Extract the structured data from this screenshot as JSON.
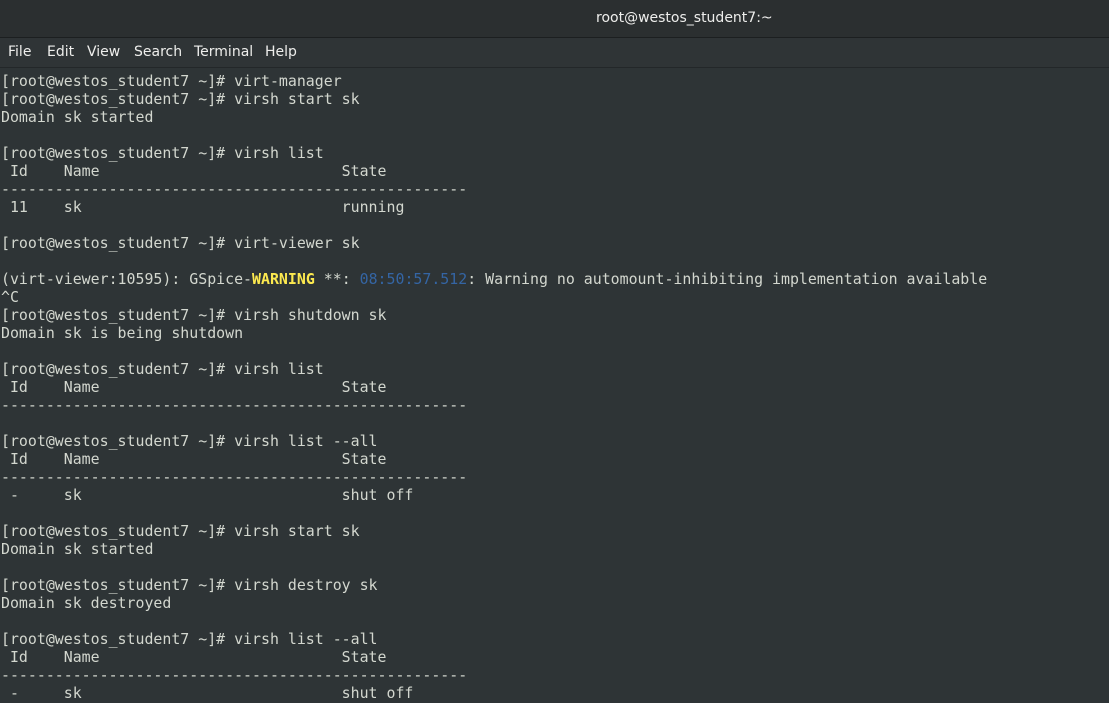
{
  "window": {
    "title": "root@westos_student7:~"
  },
  "menu": {
    "items": [
      "File",
      "Edit",
      "View",
      "Search",
      "Terminal",
      "Help"
    ]
  },
  "terminal": {
    "lines": [
      "[root@westos_student7 ~]# virt-manager",
      "[root@westos_student7 ~]# virsh start sk",
      "Domain sk started",
      "",
      "[root@westos_student7 ~]# virsh list",
      " Id    Name                           State",
      "----------------------------------------------------",
      " 11    sk                             running",
      "",
      "[root@westos_student7 ~]# virt-viewer sk",
      "",
      "(virt-viewer:10595): GSpice-|WARNING| **: |08:50:57.512|: Warning no automount-inhibiting implementation available",
      "^C",
      "[root@westos_student7 ~]# virsh shutdown sk",
      "Domain sk is being shutdown",
      "",
      "[root@westos_student7 ~]# virsh list",
      " Id    Name                           State",
      "----------------------------------------------------",
      "",
      "[root@westos_student7 ~]# virsh list --all",
      " Id    Name                           State",
      "----------------------------------------------------",
      " -     sk                             shut off",
      "",
      "[root@westos_student7 ~]# virsh start sk",
      "Domain sk started",
      "",
      "[root@westos_student7 ~]# virsh destroy sk",
      "Domain sk destroyed",
      "",
      "[root@westos_student7 ~]# virsh list --all",
      " Id    Name                           State",
      "----------------------------------------------------",
      " -     sk                             shut off"
    ],
    "colors": {
      "background": "#2e3436",
      "foreground": "#d3d7cf",
      "warning": "#fce94f",
      "timestamp": "#3465a4"
    }
  }
}
